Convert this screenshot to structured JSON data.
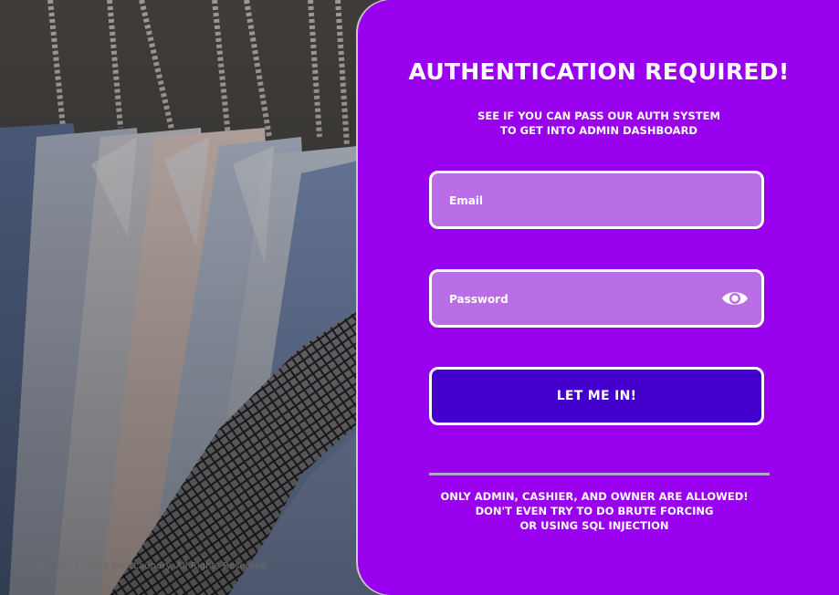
{
  "footer": {
    "copyright": "Copyright © 2023 NextLaundry. All Rights Reserved."
  },
  "auth": {
    "title": "AUTHENTICATION REQUIRED!",
    "subtitle_line1": "SEE IF YOU CAN PASS OUR AUTH SYSTEM",
    "subtitle_line2": "TO GET INTO ADMIN DASHBOARD",
    "email_placeholder": "Email",
    "email_value": "",
    "password_placeholder": "Password",
    "password_value": "",
    "password_toggle_icon": "eye-icon",
    "submit_label": "LET ME IN!",
    "notice_line1": "ONLY ADMIN, CASHIER, AND OWNER ARE ALLOWED!",
    "notice_line2": "DON'T EVEN TRY TO DO BRUTE FORCING",
    "notice_line3": "OR USING SQL INJECTION"
  },
  "colors": {
    "panel_bg": "#9900ee",
    "field_bg": "#ba6ee6",
    "button_bg": "#4400cc",
    "text": "#ffffff"
  }
}
